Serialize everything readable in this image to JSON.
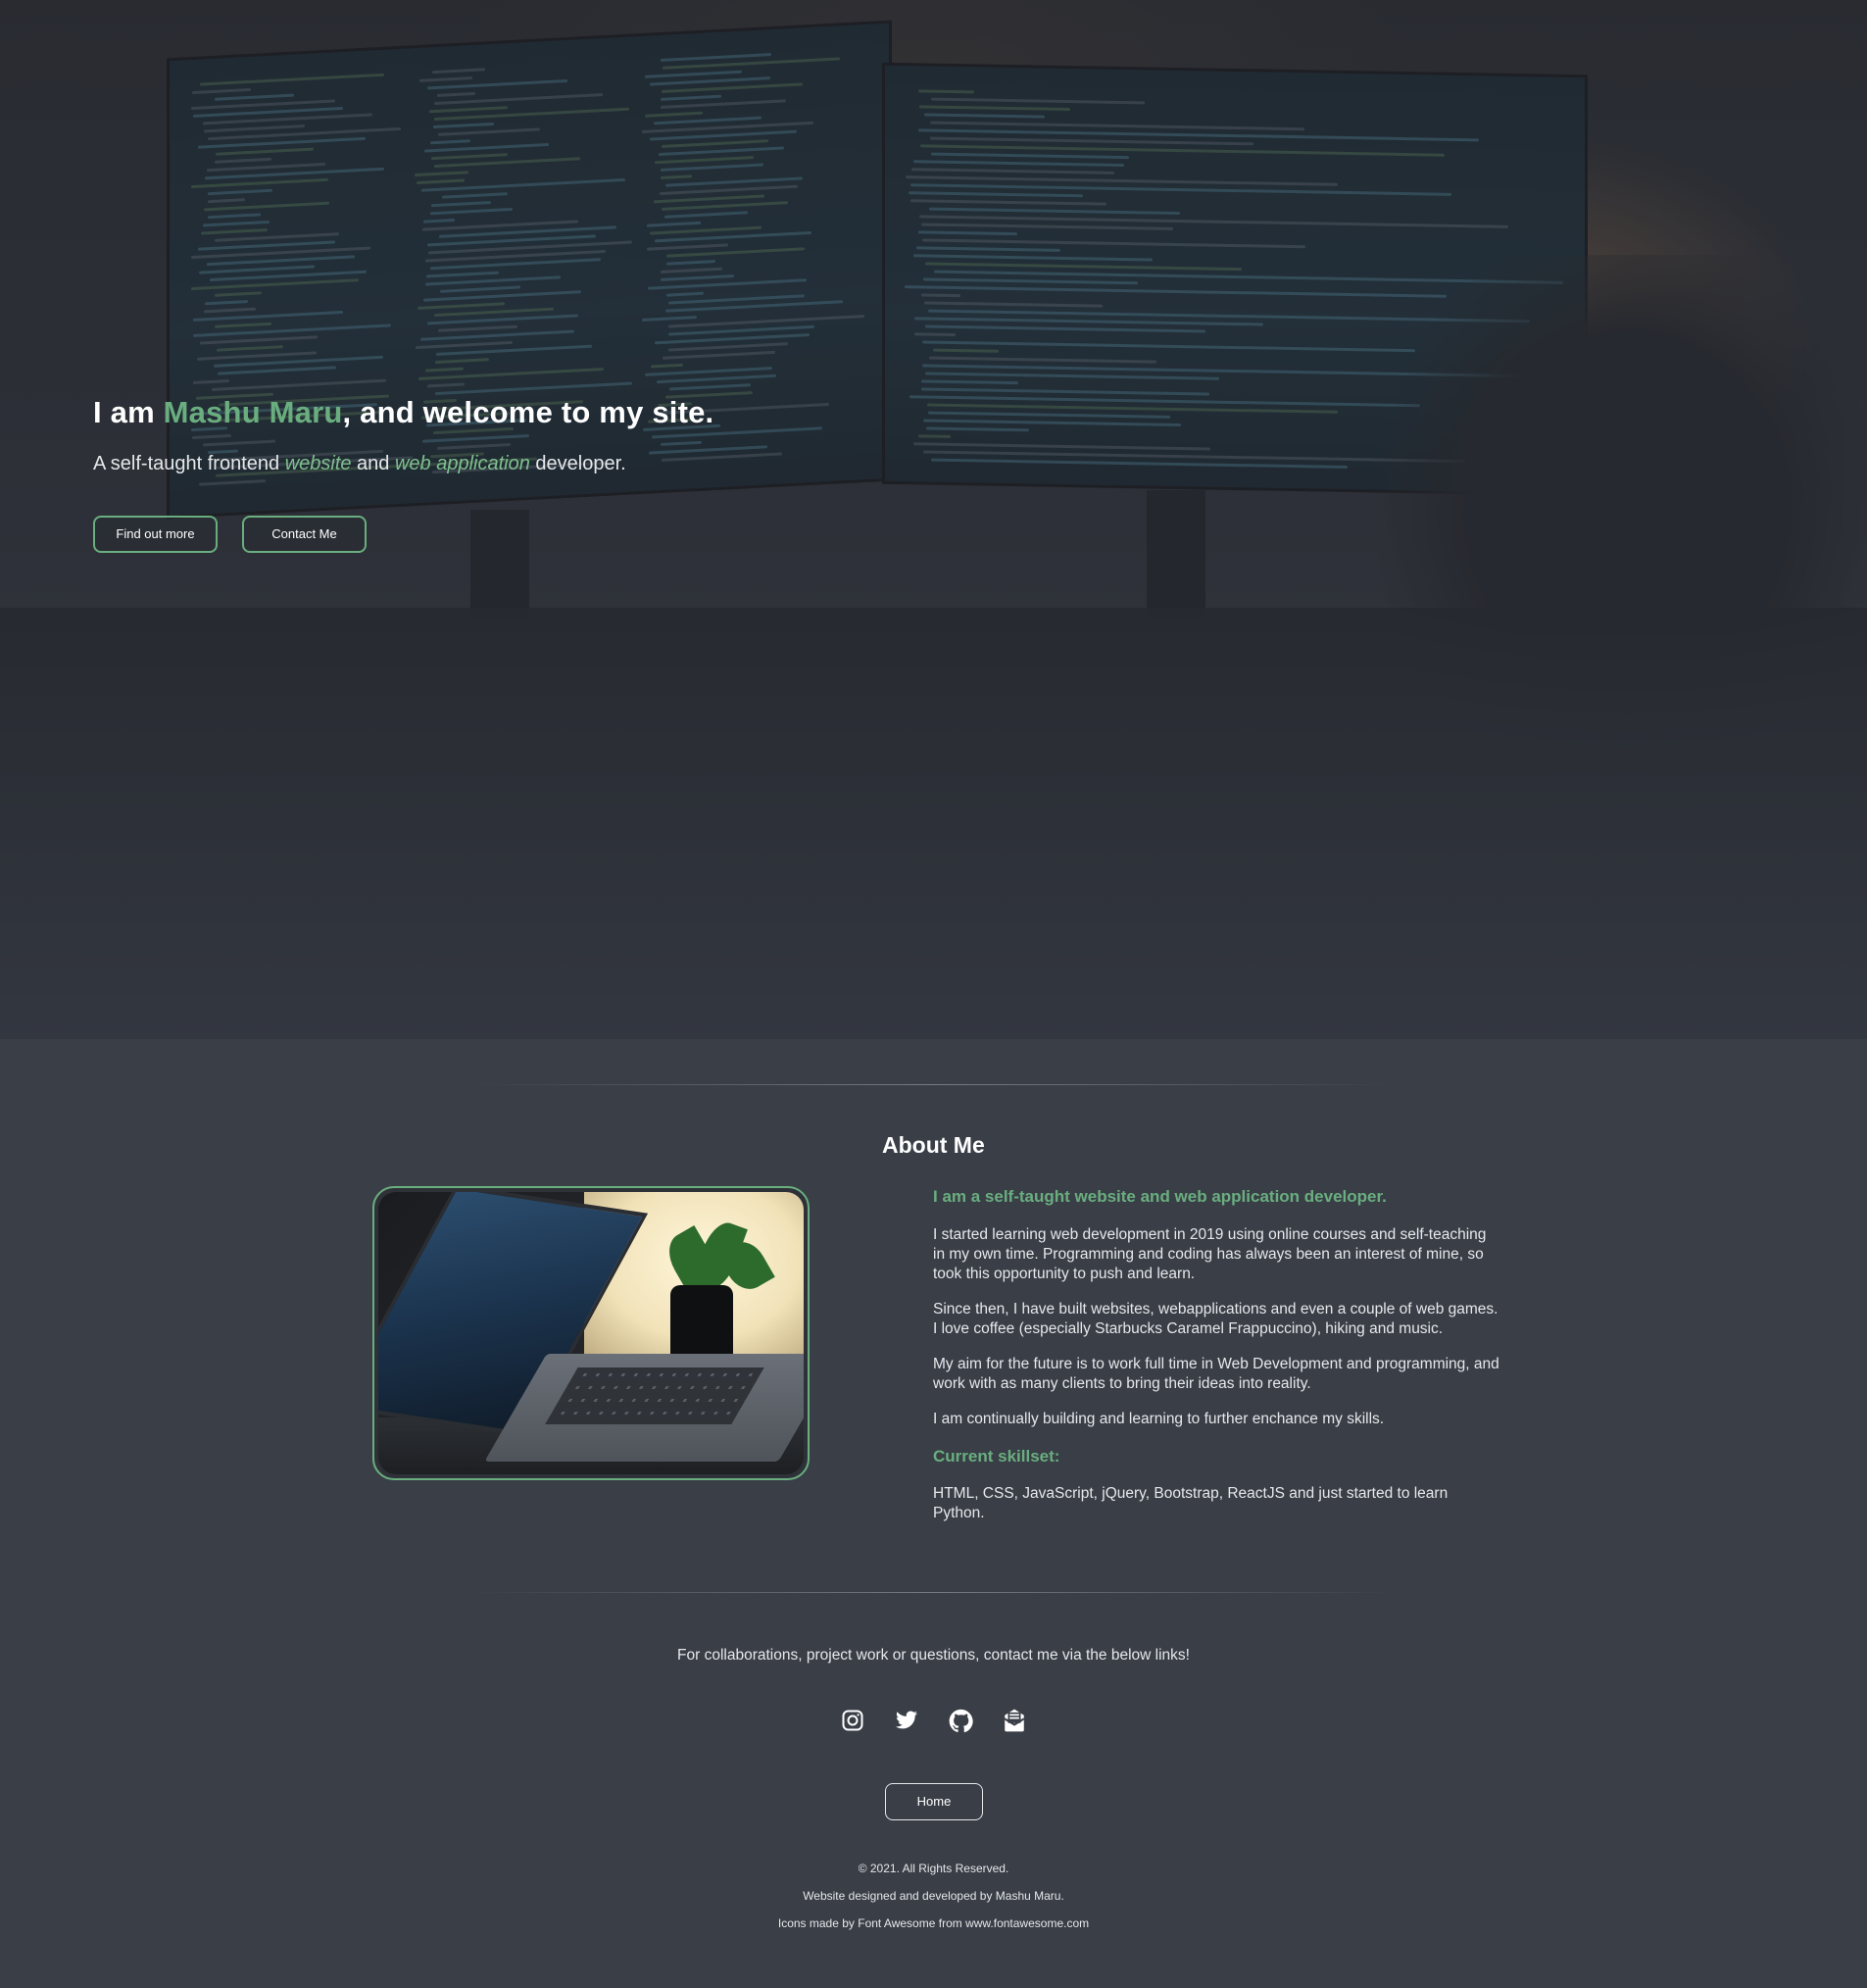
{
  "hero": {
    "title_prefix": "I am ",
    "name": "Mashu Maru",
    "title_suffix": ", and welcome to my site.",
    "subtitle_start": "A self-taught frontend ",
    "subtitle_em1": "website",
    "subtitle_mid": " and ",
    "subtitle_em2": "web application",
    "subtitle_end": " developer.",
    "buttons": {
      "find_out_more": "Find out more",
      "contact_me": "Contact Me"
    }
  },
  "about": {
    "heading": "About Me",
    "tagline": "I am a self-taught website and web application developer.",
    "paragraphs": [
      "I started learning web development in 2019 using online courses and self-teaching in my own time. Programming and coding has always been an interest of mine, so took this opportunity to push and learn.",
      "Since then, I have built websites, webapplications and even a couple of web games. I love coffee (especially Starbucks Caramel Frappuccino), hiking and music.",
      "My aim for the future is to work full time in Web Development and programming, and work with as many clients to bring their ideas into reality.",
      "I am continually building and learning to further enchance my skills."
    ],
    "skillset_heading": "Current skillset:",
    "skillset": "HTML, CSS, JavaScript, jQuery, Bootstrap, ReactJS and just started to learn Python."
  },
  "contact": {
    "text": "For collaborations, project work or questions, contact me via the below links!",
    "socials": [
      "instagram-icon",
      "twitter-icon",
      "github-icon",
      "email-icon"
    ]
  },
  "home_button": "Home",
  "footer": {
    "copyright": "© 2021. All Rights Reserved.",
    "designed_by": "Website designed and developed by Mashu Maru.",
    "icons_credit": "Icons made by Font Awesome from www.fontawesome.com"
  },
  "colors": {
    "accent": "#6aae7f",
    "background": "#393e47",
    "text": "#e6e8ea"
  }
}
